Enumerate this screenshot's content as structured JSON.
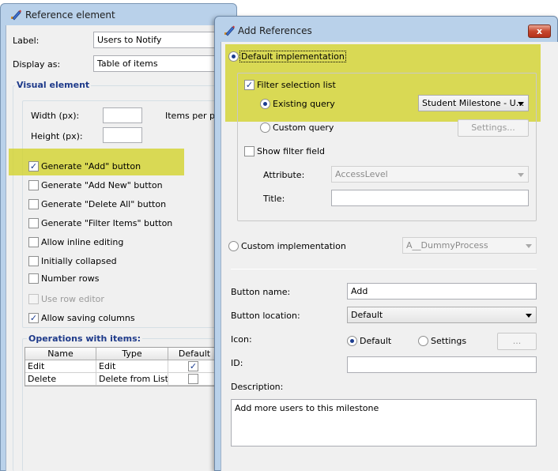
{
  "back_window": {
    "title": "Reference element",
    "label_caption": "Label:",
    "label_value": "Users to Notify",
    "display_as_caption": "Display as:",
    "display_as_value": "Table of items",
    "visual_element_title": "Visual element",
    "width_caption": "Width (px):",
    "height_caption": "Height (px):",
    "items_per_page_caption": "Items per pa",
    "checkboxes": [
      {
        "label": "Generate \"Add\" button",
        "checked": true
      },
      {
        "label": "Generate \"Add New\" button",
        "checked": false
      },
      {
        "label": "Generate \"Delete All\" button",
        "checked": false
      },
      {
        "label": "Generate \"Filter Items\" button",
        "checked": false
      },
      {
        "label": "Allow inline editing",
        "checked": false
      },
      {
        "label": "Initially collapsed",
        "checked": false
      },
      {
        "label": "Number rows",
        "checked": false
      },
      {
        "label": "Use row editor",
        "checked": false,
        "disabled": true
      },
      {
        "label": "Allow saving columns",
        "checked": true
      }
    ],
    "operations": {
      "title": "Operations with items:",
      "columns": [
        "Name",
        "Type",
        "Default"
      ],
      "rows": [
        {
          "name": "Edit",
          "type": "Edit",
          "default": true
        },
        {
          "name": "Delete",
          "type": "Delete from List",
          "default": false
        }
      ]
    }
  },
  "dialog": {
    "title": "Add References",
    "close_label": "x",
    "default_implementation": "Default implementation",
    "filter_selection_list": "Filter selection list",
    "existing_query": "Existing query",
    "existing_query_value": "Student Milestone - U...",
    "custom_query": "Custom query",
    "settings_button": "Settings...",
    "show_filter_field": "Show filter field",
    "attribute_caption": "Attribute:",
    "attribute_value": "AccessLevel",
    "title_caption": "Title:",
    "title_value": "",
    "custom_implementation": "Custom implementation",
    "custom_implementation_value": "A__DummyProcess",
    "button_name_caption": "Button name:",
    "button_name_value": "Add",
    "button_location_caption": "Button location:",
    "button_location_value": "Default",
    "icon_caption": "Icon:",
    "icon_default": "Default",
    "icon_settings": "Settings",
    "icon_browse": "...",
    "id_caption": "ID:",
    "id_value": "",
    "description_caption": "Description:",
    "description_value": "Add more users to this milestone"
  },
  "colors": {
    "highlight": "#d2d228",
    "group_title": "#1e3a8a",
    "window_frame": "#b9d1ea"
  },
  "icons": [
    "edit-pencil-icon",
    "close-icon",
    "check-icon",
    "dropdown-arrow-icon"
  ]
}
